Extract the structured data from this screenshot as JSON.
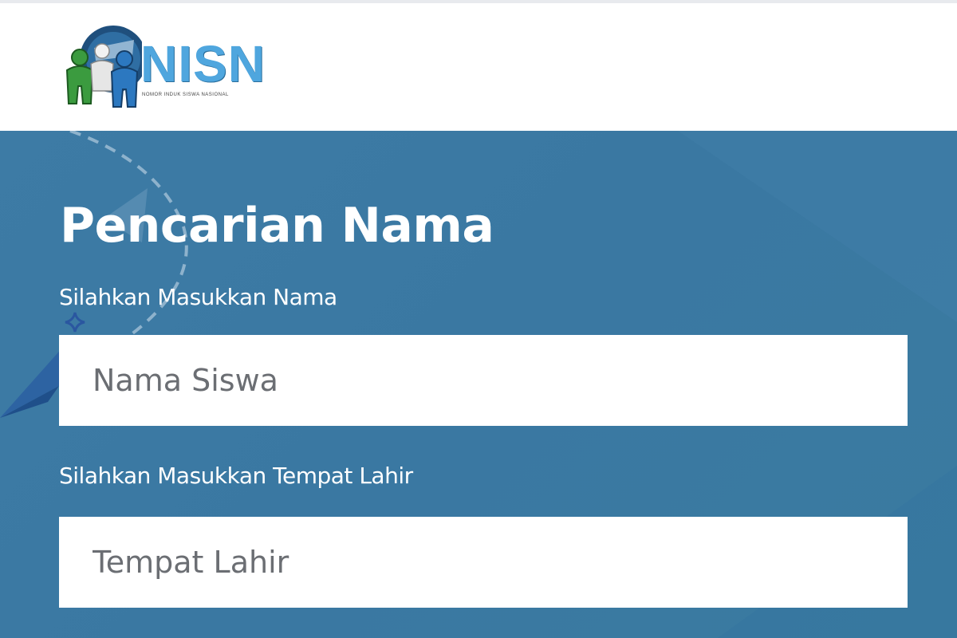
{
  "logo": {
    "text": "NISN",
    "tagline": "NOMOR INDUK SISWA NASIONAL"
  },
  "search": {
    "title": "Pencarian Nama",
    "name_label": "Silahkan Masukkan Nama",
    "name_placeholder": "Nama Siswa",
    "name_value": "",
    "birthplace_label": "Silahkan Masukkan Tempat Lahir",
    "birthplace_placeholder": "Tempat Lahir",
    "birthplace_value": ""
  },
  "colors": {
    "header_bg": "#ffffff",
    "main_bg": "#3a78a2",
    "logo_blue": "#4fa6de",
    "text_white": "#ffffff"
  }
}
